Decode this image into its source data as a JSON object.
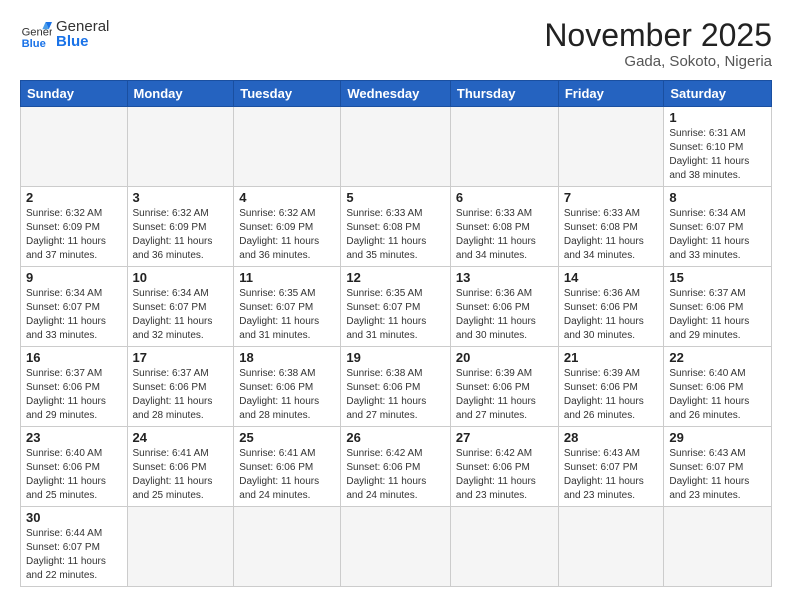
{
  "header": {
    "logo_general": "General",
    "logo_blue": "Blue",
    "month_title": "November 2025",
    "location": "Gada, Sokoto, Nigeria"
  },
  "weekdays": [
    "Sunday",
    "Monday",
    "Tuesday",
    "Wednesday",
    "Thursday",
    "Friday",
    "Saturday"
  ],
  "weeks": [
    [
      {
        "day": "",
        "info": ""
      },
      {
        "day": "",
        "info": ""
      },
      {
        "day": "",
        "info": ""
      },
      {
        "day": "",
        "info": ""
      },
      {
        "day": "",
        "info": ""
      },
      {
        "day": "",
        "info": ""
      },
      {
        "day": "1",
        "info": "Sunrise: 6:31 AM\nSunset: 6:10 PM\nDaylight: 11 hours\nand 38 minutes."
      }
    ],
    [
      {
        "day": "2",
        "info": "Sunrise: 6:32 AM\nSunset: 6:09 PM\nDaylight: 11 hours\nand 37 minutes."
      },
      {
        "day": "3",
        "info": "Sunrise: 6:32 AM\nSunset: 6:09 PM\nDaylight: 11 hours\nand 36 minutes."
      },
      {
        "day": "4",
        "info": "Sunrise: 6:32 AM\nSunset: 6:09 PM\nDaylight: 11 hours\nand 36 minutes."
      },
      {
        "day": "5",
        "info": "Sunrise: 6:33 AM\nSunset: 6:08 PM\nDaylight: 11 hours\nand 35 minutes."
      },
      {
        "day": "6",
        "info": "Sunrise: 6:33 AM\nSunset: 6:08 PM\nDaylight: 11 hours\nand 34 minutes."
      },
      {
        "day": "7",
        "info": "Sunrise: 6:33 AM\nSunset: 6:08 PM\nDaylight: 11 hours\nand 34 minutes."
      },
      {
        "day": "8",
        "info": "Sunrise: 6:34 AM\nSunset: 6:07 PM\nDaylight: 11 hours\nand 33 minutes."
      }
    ],
    [
      {
        "day": "9",
        "info": "Sunrise: 6:34 AM\nSunset: 6:07 PM\nDaylight: 11 hours\nand 33 minutes."
      },
      {
        "day": "10",
        "info": "Sunrise: 6:34 AM\nSunset: 6:07 PM\nDaylight: 11 hours\nand 32 minutes."
      },
      {
        "day": "11",
        "info": "Sunrise: 6:35 AM\nSunset: 6:07 PM\nDaylight: 11 hours\nand 31 minutes."
      },
      {
        "day": "12",
        "info": "Sunrise: 6:35 AM\nSunset: 6:07 PM\nDaylight: 11 hours\nand 31 minutes."
      },
      {
        "day": "13",
        "info": "Sunrise: 6:36 AM\nSunset: 6:06 PM\nDaylight: 11 hours\nand 30 minutes."
      },
      {
        "day": "14",
        "info": "Sunrise: 6:36 AM\nSunset: 6:06 PM\nDaylight: 11 hours\nand 30 minutes."
      },
      {
        "day": "15",
        "info": "Sunrise: 6:37 AM\nSunset: 6:06 PM\nDaylight: 11 hours\nand 29 minutes."
      }
    ],
    [
      {
        "day": "16",
        "info": "Sunrise: 6:37 AM\nSunset: 6:06 PM\nDaylight: 11 hours\nand 29 minutes."
      },
      {
        "day": "17",
        "info": "Sunrise: 6:37 AM\nSunset: 6:06 PM\nDaylight: 11 hours\nand 28 minutes."
      },
      {
        "day": "18",
        "info": "Sunrise: 6:38 AM\nSunset: 6:06 PM\nDaylight: 11 hours\nand 28 minutes."
      },
      {
        "day": "19",
        "info": "Sunrise: 6:38 AM\nSunset: 6:06 PM\nDaylight: 11 hours\nand 27 minutes."
      },
      {
        "day": "20",
        "info": "Sunrise: 6:39 AM\nSunset: 6:06 PM\nDaylight: 11 hours\nand 27 minutes."
      },
      {
        "day": "21",
        "info": "Sunrise: 6:39 AM\nSunset: 6:06 PM\nDaylight: 11 hours\nand 26 minutes."
      },
      {
        "day": "22",
        "info": "Sunrise: 6:40 AM\nSunset: 6:06 PM\nDaylight: 11 hours\nand 26 minutes."
      }
    ],
    [
      {
        "day": "23",
        "info": "Sunrise: 6:40 AM\nSunset: 6:06 PM\nDaylight: 11 hours\nand 25 minutes."
      },
      {
        "day": "24",
        "info": "Sunrise: 6:41 AM\nSunset: 6:06 PM\nDaylight: 11 hours\nand 25 minutes."
      },
      {
        "day": "25",
        "info": "Sunrise: 6:41 AM\nSunset: 6:06 PM\nDaylight: 11 hours\nand 24 minutes."
      },
      {
        "day": "26",
        "info": "Sunrise: 6:42 AM\nSunset: 6:06 PM\nDaylight: 11 hours\nand 24 minutes."
      },
      {
        "day": "27",
        "info": "Sunrise: 6:42 AM\nSunset: 6:06 PM\nDaylight: 11 hours\nand 23 minutes."
      },
      {
        "day": "28",
        "info": "Sunrise: 6:43 AM\nSunset: 6:07 PM\nDaylight: 11 hours\nand 23 minutes."
      },
      {
        "day": "29",
        "info": "Sunrise: 6:43 AM\nSunset: 6:07 PM\nDaylight: 11 hours\nand 23 minutes."
      }
    ],
    [
      {
        "day": "30",
        "info": "Sunrise: 6:44 AM\nSunset: 6:07 PM\nDaylight: 11 hours\nand 22 minutes."
      },
      {
        "day": "",
        "info": ""
      },
      {
        "day": "",
        "info": ""
      },
      {
        "day": "",
        "info": ""
      },
      {
        "day": "",
        "info": ""
      },
      {
        "day": "",
        "info": ""
      },
      {
        "day": "",
        "info": ""
      }
    ]
  ]
}
